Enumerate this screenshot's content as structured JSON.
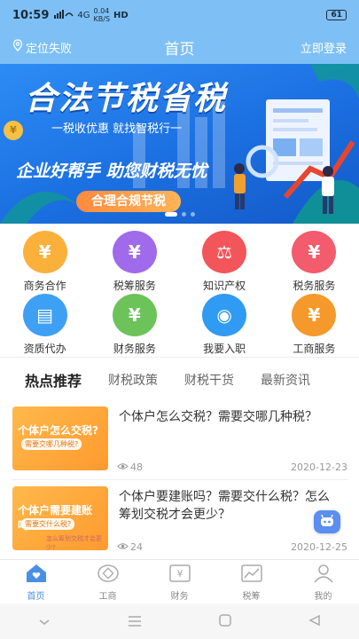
{
  "status_bar": {
    "time": "10:59",
    "signal": "4G",
    "speed_value": "0.04",
    "speed_unit": "KB/S",
    "hd": "HD",
    "battery": "61"
  },
  "nav": {
    "location": "定位失败",
    "title": "首页",
    "login": "立即登录"
  },
  "banner": {
    "title": "合法节税省税",
    "subtitle": "一税收优惠  就找智税行一",
    "slogan": "企业好帮手  助您财税无忧",
    "pill": "合理合规节税",
    "coin": "¥",
    "slide_count": 3,
    "active_slide": 0
  },
  "services": [
    {
      "label": "商务合作",
      "icon": "handshake-icon",
      "color": "#fbb03b"
    },
    {
      "label": "税筹服务",
      "icon": "cloud-yuan-icon",
      "color": "#a06bea"
    },
    {
      "label": "知识产权",
      "icon": "gavel-icon",
      "color": "#f2555a"
    },
    {
      "label": "税务服务",
      "icon": "piggy-bank-icon",
      "color": "#f25c6c"
    },
    {
      "label": "资质代办",
      "icon": "card-yuan-icon",
      "color": "#3da0f5"
    },
    {
      "label": "财务服务",
      "icon": "coin-hand-icon",
      "color": "#6cc35a"
    },
    {
      "label": "我要入职",
      "icon": "coin-badge-icon",
      "color": "#2f9bf2"
    },
    {
      "label": "工商服务",
      "icon": "bank-building-icon",
      "color": "#f59a2a"
    }
  ],
  "tabs": [
    "热点推荐",
    "财税政策",
    "财税干货",
    "最新资讯"
  ],
  "articles": [
    {
      "title": "个体户怎么交税？需要交哪几种税？",
      "thumb_title": "个体户怎么交税?",
      "thumb_sub": "需要交哪几种税?",
      "thumb_note": "",
      "views": "48",
      "date": "2020-12-23"
    },
    {
      "title": "个体户要建账吗？需要交什么税？怎么筹划交税才会更少？",
      "thumb_title": "个体户需要建账吗?",
      "thumb_sub": "需要交什么税?",
      "thumb_note": "怎么筹划交税才会更少?",
      "views": "24",
      "date": "2020-12-25"
    }
  ],
  "tab_bar": [
    {
      "label": "首页",
      "icon": "home-icon",
      "active": true
    },
    {
      "label": "工商",
      "icon": "business-icon",
      "active": false
    },
    {
      "label": "财务",
      "icon": "finance-icon",
      "active": false
    },
    {
      "label": "税筹",
      "icon": "tax-chart-icon",
      "active": false
    },
    {
      "label": "我的",
      "icon": "profile-icon",
      "active": false
    }
  ],
  "colors": {
    "primary": "#7ec0f5",
    "accent": "#4a90e2",
    "orange": "#ff9a2f"
  }
}
